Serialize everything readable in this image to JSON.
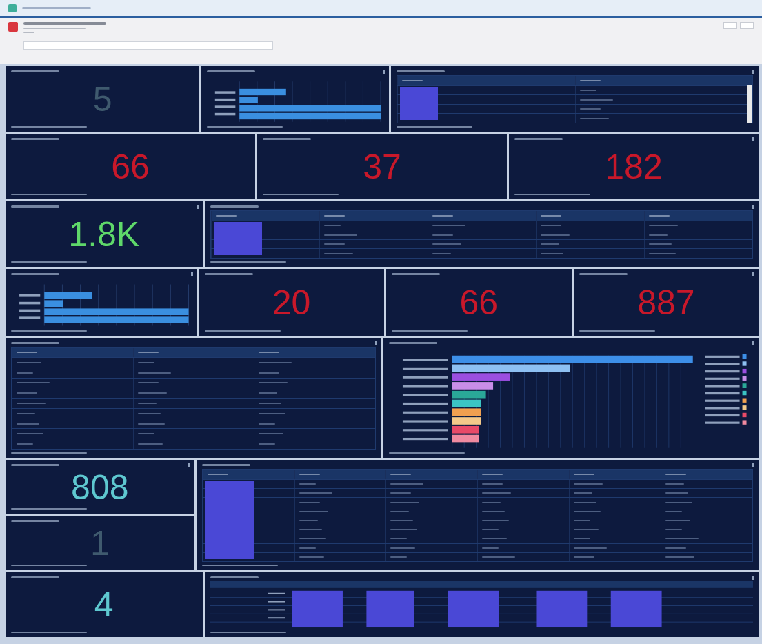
{
  "rows": [
    [
      {
        "kind": "kpi",
        "value": "5",
        "color": "#3f5a6e"
      },
      {
        "kind": "status_bars"
      },
      {
        "kind": "student_table"
      }
    ],
    [
      {
        "kind": "kpi",
        "value": "66",
        "color": "#c8182a"
      },
      {
        "kind": "kpi",
        "value": "37",
        "color": "#c8182a"
      },
      {
        "kind": "kpi",
        "value": "182",
        "color": "#c8182a"
      }
    ],
    [
      {
        "kind": "kpi",
        "value": "1.8K",
        "color": "#5fd86a"
      },
      {
        "kind": "service_table"
      }
    ],
    [
      {
        "kind": "status_bars"
      },
      {
        "kind": "kpi",
        "value": "20",
        "color": "#c8182a"
      },
      {
        "kind": "kpi",
        "value": "66",
        "color": "#c8182a"
      },
      {
        "kind": "kpi",
        "value": "887",
        "color": "#c8182a"
      }
    ],
    [
      {
        "kind": "reason_table"
      },
      {
        "kind": "ranked_bars"
      }
    ],
    [
      {
        "kind": "stack",
        "children": [
          {
            "kind": "kpi",
            "value": "808",
            "color": "#5ec8d0"
          },
          {
            "kind": "kpi",
            "value": "1",
            "color": "#3f5a6e"
          }
        ]
      },
      {
        "kind": "detail_table"
      }
    ],
    [
      {
        "kind": "kpi",
        "value": "4",
        "color": "#5ec8d0"
      },
      {
        "kind": "timeline"
      }
    ]
  ]
}
